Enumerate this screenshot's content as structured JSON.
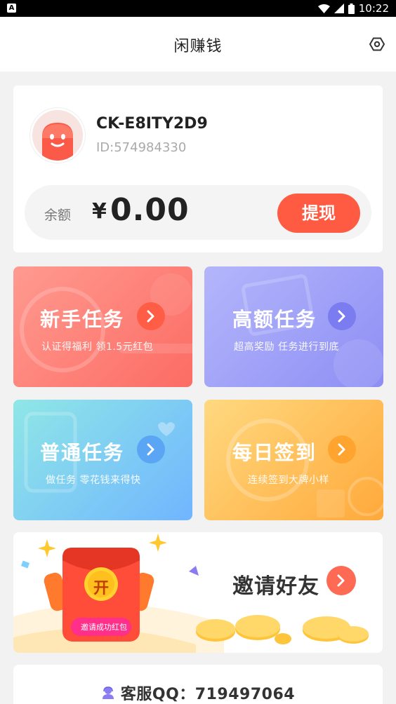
{
  "status_bar": {
    "time": "10:22",
    "left_icon": "A",
    "icons": [
      "wifi-icon",
      "signal-icon",
      "battery-icon"
    ]
  },
  "header": {
    "title": "闲赚钱",
    "settings_icon": "settings-icon"
  },
  "user": {
    "name": "CK-E8ITY2D9",
    "id_text": "ID:574984330"
  },
  "balance": {
    "label": "余额",
    "currency": "¥",
    "amount": "0.00",
    "withdraw_label": "提现"
  },
  "tasks": [
    {
      "title": "新手任务",
      "subtitle": "认证得福利 领1.5元红包",
      "color": "#fc6c64"
    },
    {
      "title": "高额任务",
      "subtitle": "超高奖励 任务进行到底",
      "color": "#8d8ef4"
    },
    {
      "title": "普通任务",
      "subtitle": "做任务 零花钱来得快",
      "color": "#70b5ff"
    },
    {
      "title": "每日签到",
      "subtitle": "连续签到大牌小样",
      "color": "#ffa93a"
    }
  ],
  "invite": {
    "title": "邀请好友",
    "envelope_char": "开",
    "badge_text": "邀请成功红包"
  },
  "service": {
    "text": "客服QQ：719497064",
    "icon": "support-agent-icon"
  },
  "colors": {
    "accent": "#ff5b42",
    "background": "#f2f2f2"
  }
}
